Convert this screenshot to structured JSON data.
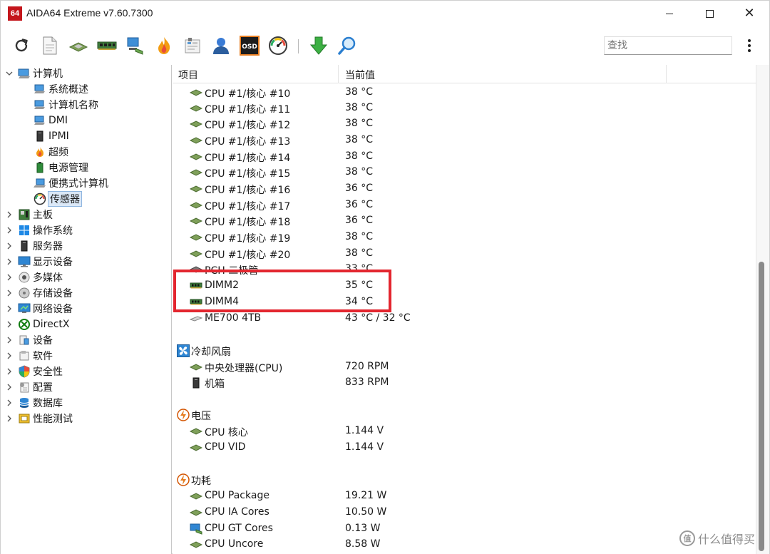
{
  "window": {
    "logo_text": "64",
    "title": "AIDA64 Extreme v7.60.7300",
    "close_glyph": "✕"
  },
  "toolbar": {
    "icons": [
      "refresh-icon",
      "report-icon",
      "motherboard-icon",
      "memory-icon",
      "network-icon",
      "overclock-icon",
      "benchmark-icon",
      "user-icon",
      "osd-icon",
      "sensor-gauge-icon",
      "update-download-icon",
      "search-icon"
    ],
    "osd_label": "OSD",
    "search_placeholder": "查找"
  },
  "tree": {
    "root": {
      "label": "计算机"
    },
    "children": [
      {
        "label": "系统概述"
      },
      {
        "label": "计算机名称"
      },
      {
        "label": "DMI"
      },
      {
        "label": "IPMI"
      },
      {
        "label": "超频"
      },
      {
        "label": "电源管理"
      },
      {
        "label": "便携式计算机"
      },
      {
        "label": "传感器"
      }
    ],
    "categories": [
      {
        "label": "主板"
      },
      {
        "label": "操作系统"
      },
      {
        "label": "服务器"
      },
      {
        "label": "显示设备"
      },
      {
        "label": "多媒体"
      },
      {
        "label": "存储设备"
      },
      {
        "label": "网络设备"
      },
      {
        "label": "DirectX"
      },
      {
        "label": "设备"
      },
      {
        "label": "软件"
      },
      {
        "label": "安全性"
      },
      {
        "label": "配置"
      },
      {
        "label": "数据库"
      },
      {
        "label": "性能测试"
      }
    ],
    "selected": "传感器"
  },
  "list": {
    "col_item": "项目",
    "col_value": "当前值",
    "temp_rows": [
      {
        "label": "CPU #1/核心 #10",
        "value": "38 °C"
      },
      {
        "label": "CPU #1/核心 #11",
        "value": "38 °C"
      },
      {
        "label": "CPU #1/核心 #12",
        "value": "38 °C"
      },
      {
        "label": "CPU #1/核心 #13",
        "value": "38 °C"
      },
      {
        "label": "CPU #1/核心 #14",
        "value": "38 °C"
      },
      {
        "label": "CPU #1/核心 #15",
        "value": "38 °C"
      },
      {
        "label": "CPU #1/核心 #16",
        "value": "36 °C"
      },
      {
        "label": "CPU #1/核心 #17",
        "value": "36 °C"
      },
      {
        "label": "CPU #1/核心 #18",
        "value": "36 °C"
      },
      {
        "label": "CPU #1/核心 #19",
        "value": "38 °C"
      },
      {
        "label": "CPU #1/核心 #20",
        "value": "38 °C"
      },
      {
        "label": "PCH 二极管",
        "value": "33 °C"
      },
      {
        "label": "DIMM2",
        "value": "35 °C"
      },
      {
        "label": "DIMM4",
        "value": "34 °C"
      },
      {
        "label": "ME700 4TB",
        "value": "43 °C / 32 °C"
      }
    ],
    "fan_group": "冷却风扇",
    "fan_rows": [
      {
        "label": "中央处理器(CPU)",
        "value": "720 RPM"
      },
      {
        "label": "机箱",
        "value": "833 RPM"
      }
    ],
    "voltage_group": "电压",
    "voltage_rows": [
      {
        "label": "CPU 核心",
        "value": "1.144 V"
      },
      {
        "label": "CPU VID",
        "value": "1.144 V"
      }
    ],
    "power_group": "功耗",
    "power_rows": [
      {
        "label": "CPU Package",
        "value": "19.21 W"
      },
      {
        "label": "CPU IA Cores",
        "value": "10.50 W"
      },
      {
        "label": "CPU GT Cores",
        "value": "0.13 W"
      },
      {
        "label": "CPU Uncore",
        "value": "8.58 W"
      }
    ]
  },
  "watermark": {
    "logo_text": "值",
    "text": "什么值得买"
  },
  "colors": {
    "highlight": "#e3262f",
    "selection": "#dbe8f7",
    "logo_red": "#c4161c"
  }
}
